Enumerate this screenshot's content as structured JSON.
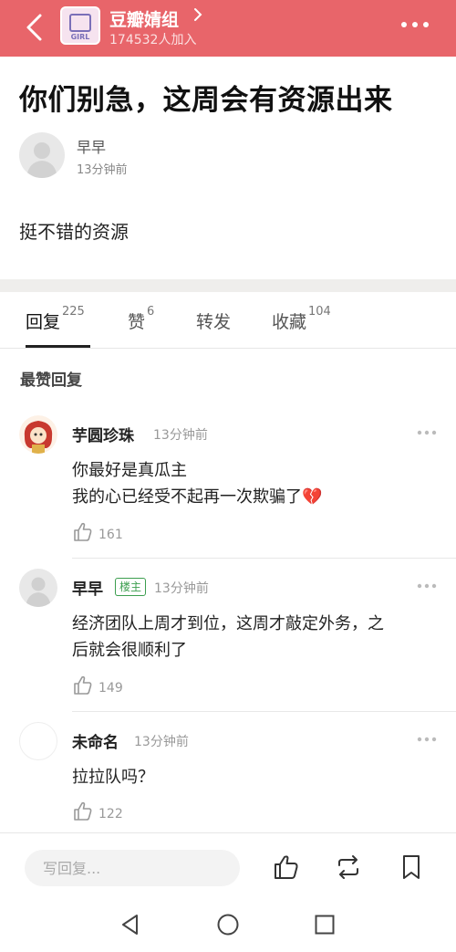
{
  "header": {
    "group_name": "豆瓣婧组",
    "member_count": "174532人加入",
    "logo_text": "GIRL",
    "bg_color": "#e8656a"
  },
  "post": {
    "title": "你们别急，这周会有资源出来",
    "author": "早早",
    "time": "13分钟前",
    "body": "挺不错的资源"
  },
  "tabs": [
    {
      "label": "回复",
      "count": "225"
    },
    {
      "label": "赞",
      "count": "6"
    },
    {
      "label": "转发",
      "count": ""
    },
    {
      "label": "收藏",
      "count": "104"
    }
  ],
  "section_title": "最赞回复",
  "comments": [
    {
      "name": "芋圆珍珠",
      "time": "13分钟前",
      "op_badge": "",
      "lines": [
        "你最好是真瓜主",
        "我的心已经受不起再一次欺骗了💔"
      ],
      "likes": "161",
      "avatar": "cartoon-girl-avatar"
    },
    {
      "name": "早早",
      "time": "13分钟前",
      "op_badge": "楼主",
      "lines": [
        "经济团队上周才到位，这周才敲定外务，之",
        "后就会很顺利了"
      ],
      "likes": "149",
      "avatar": "default-avatar"
    },
    {
      "name": "未命名",
      "time": "13分钟前",
      "op_badge": "",
      "lines": [
        "拉拉队吗？"
      ],
      "likes": "122",
      "avatar": "blank-avatar"
    }
  ],
  "bottom_bar": {
    "reply_placeholder": "写回复..."
  },
  "icons": {
    "back": "back-arrow-icon",
    "more": "more-dots-icon",
    "like": "thumbs-up-icon",
    "repost": "repost-icon",
    "bookmark": "bookmark-icon"
  }
}
